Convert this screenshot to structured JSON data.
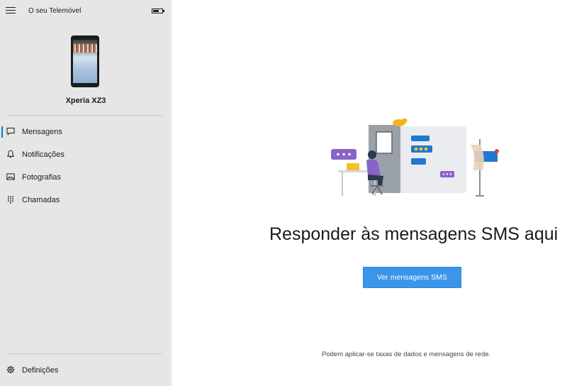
{
  "app": {
    "title": "O seu Telemóvel"
  },
  "device": {
    "name": "Xperia XZ3"
  },
  "nav": {
    "items": [
      {
        "label": "Mensagens",
        "icon": "message-icon",
        "active": true
      },
      {
        "label": "Notificações",
        "icon": "bell-icon",
        "active": false
      },
      {
        "label": "Fotografias",
        "icon": "photo-icon",
        "active": false
      },
      {
        "label": "Chamadas",
        "icon": "dialpad-icon",
        "active": false
      }
    ],
    "settings_label": "Definições"
  },
  "main": {
    "headline": "Responder às mensagens SMS aqui",
    "cta_label": "Ver mensagens SMS",
    "footnote": "Podem aplicar-se taxas de dados e mensagens de rede."
  },
  "colors": {
    "accent": "#0078d7",
    "button": "#3b96ea",
    "sidebar_bg": "#e6e6e6"
  }
}
